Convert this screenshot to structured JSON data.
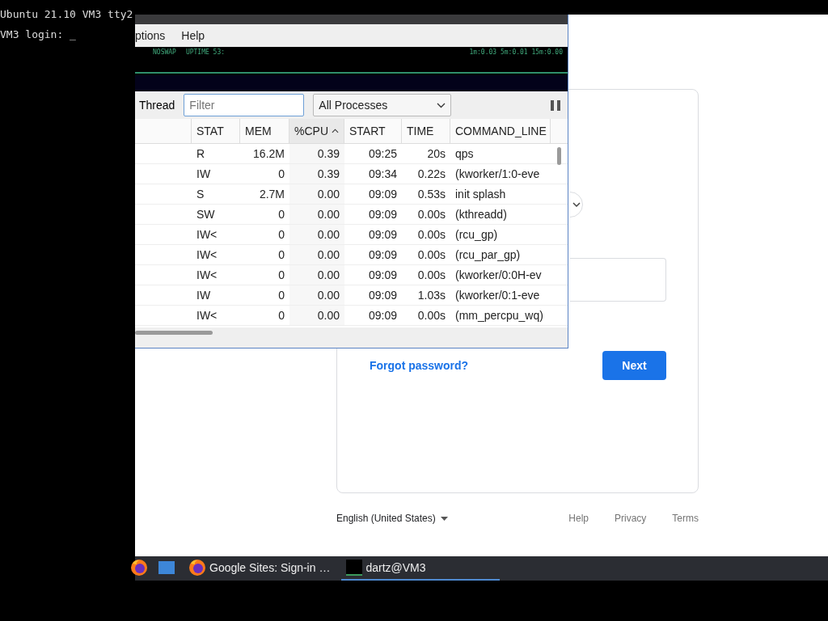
{
  "console": {
    "lines": [
      "Ubuntu 21.10 VM3 tty2",
      "VM3 login: _"
    ]
  },
  "browser": {
    "forgot_link": "Forgot password?",
    "next_button": "Next",
    "footer": {
      "language": "English (United States)",
      "links": [
        "Help",
        "Privacy",
        "Terms"
      ]
    }
  },
  "qps": {
    "menu": [
      "ptions",
      "Help"
    ],
    "graph": {
      "left": [
        "NOSWAP",
        "UPTIME 53:"
      ],
      "right": "1m:0.03 5m:0.01 15m:0.00"
    },
    "toolbar": {
      "thread_label": "Thread",
      "filter": {
        "placeholder": "Filter"
      },
      "scope": "All Processes"
    },
    "table": {
      "columns": [
        {
          "sorted": false
        },
        {
          "label": "STAT",
          "sorted": false
        },
        {
          "label": "MEM",
          "sorted": false
        },
        {
          "label": "%CPU",
          "sorted": true
        },
        {
          "label": "START",
          "sorted": false
        },
        {
          "label": "TIME",
          "sorted": false
        },
        {
          "label": "COMMAND_LINE",
          "sorted": false
        }
      ],
      "rows": [
        [
          "",
          "R",
          "16.2M",
          "0.39",
          "09:25",
          "20s",
          "qps"
        ],
        [
          "",
          "IW",
          "0",
          "0.39",
          "09:34",
          "0.22s",
          "(kworker/1:0-eve"
        ],
        [
          "",
          "S",
          "2.7M",
          "0.00",
          "09:09",
          "0.53s",
          "init splash"
        ],
        [
          "",
          "SW",
          "0",
          "0.00",
          "09:09",
          "0.00s",
          "(kthreadd)"
        ],
        [
          "",
          "IW<",
          "0",
          "0.00",
          "09:09",
          "0.00s",
          "(rcu_gp)"
        ],
        [
          "",
          "IW<",
          "0",
          "0.00",
          "09:09",
          "0.00s",
          "(rcu_par_gp)"
        ],
        [
          "",
          "IW<",
          "0",
          "0.00",
          "09:09",
          "0.00s",
          "(kworker/0:0H-ev"
        ],
        [
          "",
          "IW",
          "0",
          "0.00",
          "09:09",
          "1.03s",
          "(kworker/0:1-eve"
        ],
        [
          "",
          "IW<",
          "0",
          "0.00",
          "09:09",
          "0.00s",
          "(mm_percpu_wq)"
        ]
      ]
    }
  },
  "taskbar": {
    "items": [
      {
        "kind": "launcher",
        "selected": false
      },
      {
        "kind": "launcher",
        "selected": false
      },
      {
        "kind": "task",
        "label": "Google Sites: Sign-in …",
        "selected": false
      },
      {
        "kind": "task",
        "label": "dartz@VM3",
        "selected": true
      }
    ]
  }
}
